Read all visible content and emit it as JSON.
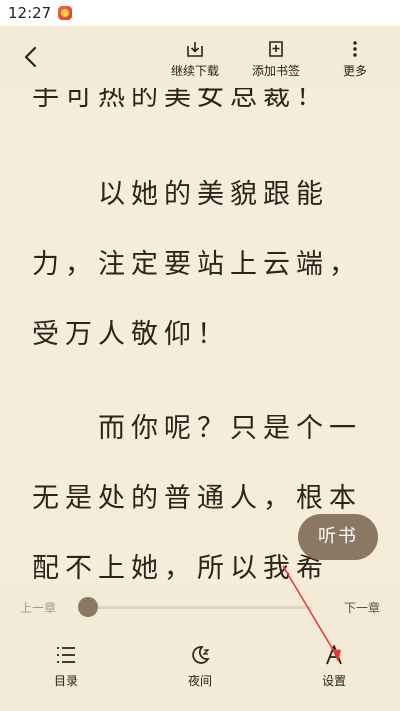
{
  "status_bar": {
    "time": "12:27",
    "app_icon": "app-notification-icon"
  },
  "top_toolbar": {
    "back_icon": "back-arrow-icon",
    "download_label": "继续下载",
    "bookmark_label": "添加书签",
    "more_label": "更多"
  },
  "reader": {
    "lines": [
      "手可热的美女总裁！",
      "　　以她的美貌跟能",
      "力，注定要站上云端，",
      "受万人敬仰！",
      "　　而你呢？只是个一",
      "无是处的普通人，根本",
      "配不上她，所以我希"
    ]
  },
  "listen_button": {
    "label": "听书"
  },
  "progress": {
    "prev_label": "上一章",
    "next_label": "下一章",
    "value": 0
  },
  "bottom_toolbar": {
    "toc_label": "目录",
    "night_label": "夜间",
    "settings_label": "设置"
  },
  "colors": {
    "page_bg": "#f5ecd9",
    "accent": "#8a7862",
    "annotation": "#e53935"
  }
}
